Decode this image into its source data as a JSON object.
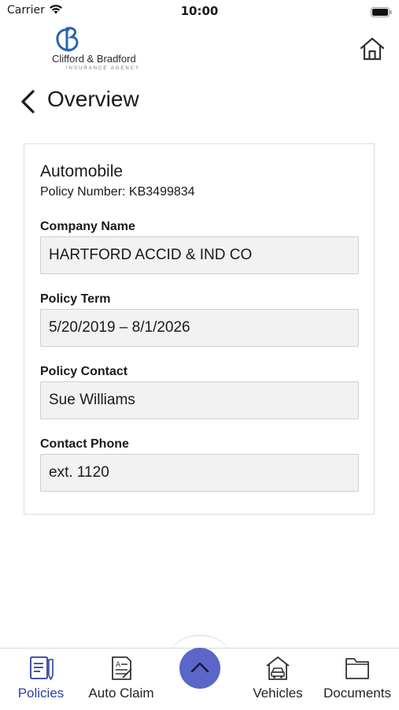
{
  "status_bar": {
    "carrier": "Carrier",
    "time": "10:00"
  },
  "header": {
    "logo_name": "Clifford & Bradford",
    "logo_subtitle": "INSURANCE AGENCY",
    "title": "Overview"
  },
  "policy": {
    "type": "Automobile",
    "number_text": "Policy Number: KB3499834",
    "fields": [
      {
        "label": "Company Name",
        "value": "HARTFORD ACCID & IND CO"
      },
      {
        "label": "Policy Term",
        "value": "5/20/2019 – 8/1/2026"
      },
      {
        "label": "Policy Contact",
        "value": "Sue Williams"
      },
      {
        "label": "Contact Phone",
        "value": "ext. 1120"
      }
    ]
  },
  "tabs": [
    {
      "label": "Policies",
      "icon": "policies-icon",
      "active": true
    },
    {
      "label": "Auto Claim",
      "icon": "auto-claim-icon",
      "active": false
    },
    {
      "label": "Vehicles",
      "icon": "vehicles-icon",
      "active": false
    },
    {
      "label": "Documents",
      "icon": "documents-icon",
      "active": false
    }
  ],
  "colors": {
    "accent": "#2c3e9e",
    "fab": "#5a67c8",
    "field_bg": "#f2f2f2"
  }
}
